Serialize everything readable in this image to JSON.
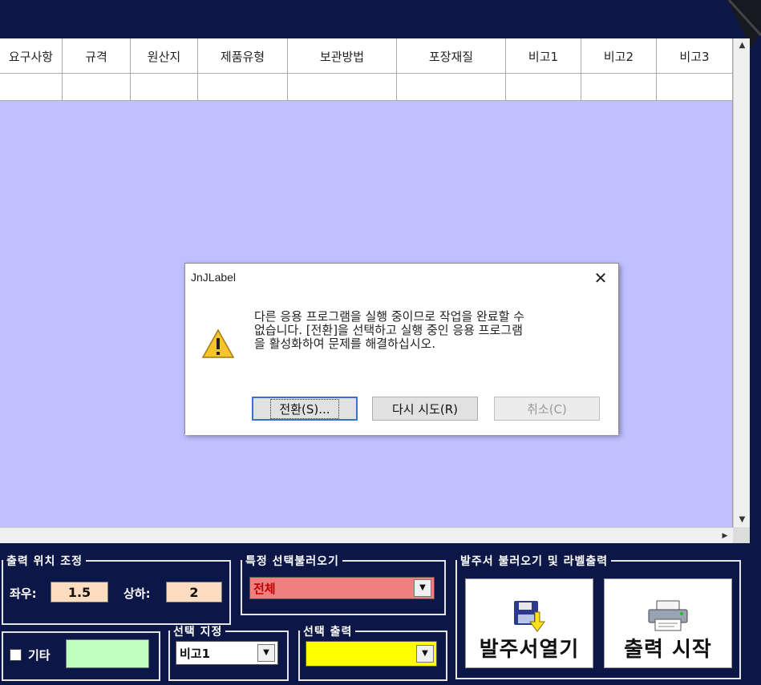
{
  "grid": {
    "columns": [
      "요구사항",
      "규격",
      "원산지",
      "제품유형",
      "보관방법",
      "포장재질",
      "비고1",
      "비고2",
      "비고3"
    ]
  },
  "dialog": {
    "title": "JnJLabel",
    "close": "✕",
    "message_line1": "다른 응용 프로그램을 실행 중이므로 작업을 완료할 수",
    "message_line2": "없습니다. [전환]을 선택하고 실행 중인 응용 프로그램",
    "message_line3": "을 활성화하여 문제를 해결하십시오.",
    "switch_button": "전환(S)...",
    "retry_button": "다시 시도(R)",
    "cancel_button": "취소(C)"
  },
  "bottom": {
    "position_group": {
      "legend": "출력 위치 조정",
      "lr_label": "좌우:",
      "lr_value": "1.5",
      "ud_label": "상하:",
      "ud_value": "2"
    },
    "special_group": {
      "legend": "특정 선택불러오기",
      "value": "전체"
    },
    "other": {
      "checkbox_label": "기타"
    },
    "select_group": {
      "legend": "선택 지정",
      "value": "비고1"
    },
    "select_output_group": {
      "legend": "선택 출력",
      "value": ""
    },
    "order_group": {
      "legend": "발주서 불러오기 및 라벨출력",
      "open_button": "발주서열기",
      "print_button": "출력 시작"
    }
  },
  "colors": {
    "background": "#0d1747",
    "grid_area": "#c0c0ff",
    "special_combo": "#f08080",
    "select_output_combo": "#ffff00",
    "other_field": "#c0ffc0",
    "value_box": "#fddcbf"
  },
  "icons": {
    "dialog": "warning-icon",
    "open_button": "floppy-disk-arrow-icon",
    "print_button": "printer-icon"
  }
}
